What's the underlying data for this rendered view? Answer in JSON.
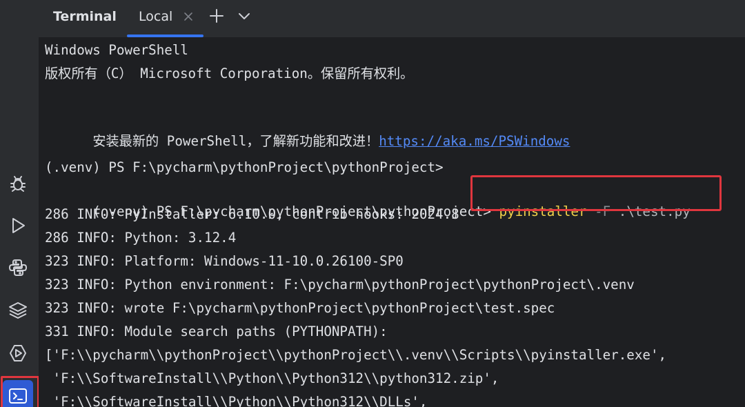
{
  "header": {
    "title": "Terminal",
    "tab_label": "Local"
  },
  "sidebar": {
    "items": [
      {
        "name": "debug",
        "icon": "bug-icon"
      },
      {
        "name": "run",
        "icon": "play-icon"
      },
      {
        "name": "python-console",
        "icon": "python-icon"
      },
      {
        "name": "layers",
        "icon": "layers-icon"
      },
      {
        "name": "services",
        "icon": "services-icon"
      },
      {
        "name": "terminal",
        "icon": "terminal-icon",
        "active": true
      }
    ]
  },
  "terminal": {
    "lines": [
      "Windows PowerShell",
      "版权所有（C） Microsoft Corporation。保留所有权利。",
      "",
      "",
      "",
      "(.venv) PS F:\\pycharm\\pythonProject\\pythonProject>",
      "",
      "286 INFO: PyInstaller: 6.10.0, contrib hooks: 2024.8",
      "286 INFO: Python: 3.12.4",
      "323 INFO: Platform: Windows-11-10.0.26100-SP0",
      "323 INFO: Python environment: F:\\pycharm\\pythonProject\\pythonProject\\.venv",
      "323 INFO: wrote F:\\pycharm\\pythonProject\\pythonProject\\test.spec",
      "331 INFO: Module search paths (PYTHONPATH):",
      "['F:\\\\pycharm\\\\pythonProject\\\\pythonProject\\\\.venv\\\\Scripts\\\\pyinstaller.exe',",
      " 'F:\\\\SoftwareInstall\\\\Python\\\\Python312\\\\python312.zip',",
      " 'F:\\\\SoftwareInstall\\\\Python\\\\Python312\\\\DLLs',"
    ],
    "install_line": {
      "text": "安装最新的 PowerShell，了解新功能和改进！",
      "link": "https://aka.ms/PSWindows"
    },
    "command_line": {
      "prompt": "(.venv) PS F:\\pycharm\\pythonProject\\pythonProject>",
      "command": "pyinstaller",
      "flag": "-F",
      "arg": ".\\test.py"
    }
  },
  "colors": {
    "background": "#1e1f22",
    "panel": "#2b2d30",
    "accent": "#3574f0",
    "highlight_border": "#e0363e",
    "command": "#f0d14a",
    "link": "#548af7"
  }
}
